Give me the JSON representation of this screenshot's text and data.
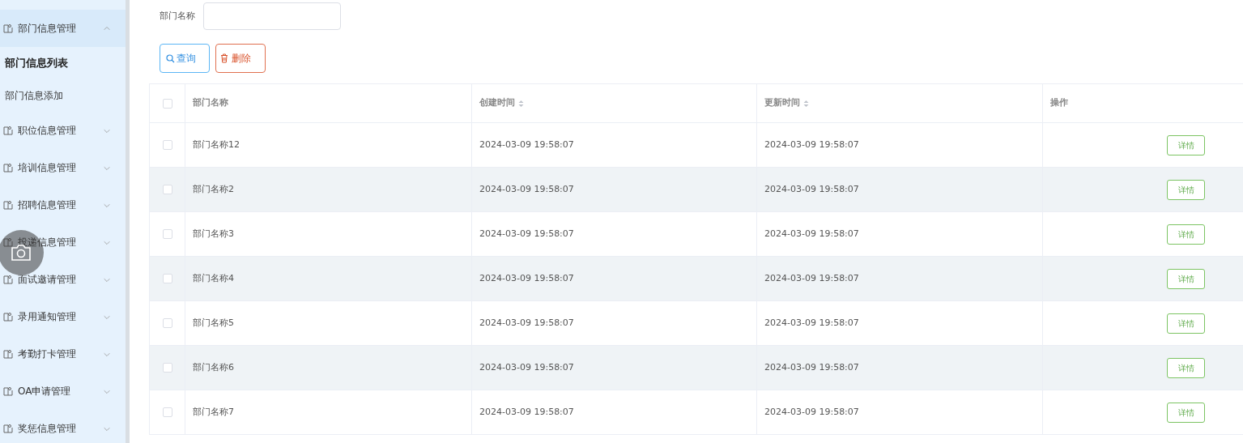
{
  "sidebar": {
    "items": [
      {
        "label": "部门信息管理",
        "expanded": true,
        "children": [
          {
            "label": "部门信息列表",
            "selected": true
          },
          {
            "label": "部门信息添加",
            "selected": false
          }
        ]
      },
      {
        "label": "职位信息管理",
        "expanded": false
      },
      {
        "label": "培训信息管理",
        "expanded": false
      },
      {
        "label": "招聘信息管理",
        "expanded": false
      },
      {
        "label": "投递信息管理",
        "expanded": false
      },
      {
        "label": "面试邀请管理",
        "expanded": false
      },
      {
        "label": "录用通知管理",
        "expanded": false
      },
      {
        "label": "考勤打卡管理",
        "expanded": false
      },
      {
        "label": "OA申请管理",
        "expanded": false
      },
      {
        "label": "奖惩信息管理",
        "expanded": false
      }
    ]
  },
  "search": {
    "label": "部门名称"
  },
  "buttons": [
    {
      "label": "查询",
      "kind": "query"
    },
    {
      "label": "删除",
      "kind": "delete"
    }
  ],
  "table": {
    "all_checked": false,
    "columns": [
      {
        "label": "部门名称",
        "sortable": false
      },
      {
        "label": "创建时间",
        "sortable": true
      },
      {
        "label": "更新时间",
        "sortable": true
      },
      {
        "label": "操作",
        "sortable": false
      }
    ],
    "rows": [
      {
        "checked": false,
        "name": "部门名称12",
        "created": "2024-03-09 19:58:07",
        "updated": "2024-03-09 19:58:07",
        "action": "详情"
      },
      {
        "checked": false,
        "name": "部门名称2",
        "created": "2024-03-09 19:58:07",
        "updated": "2024-03-09 19:58:07",
        "action": "详情"
      },
      {
        "checked": false,
        "name": "部门名称3",
        "created": "2024-03-09 19:58:07",
        "updated": "2024-03-09 19:58:07",
        "action": "详情"
      },
      {
        "checked": false,
        "name": "部门名称4",
        "created": "2024-03-09 19:58:07",
        "updated": "2024-03-09 19:58:07",
        "action": "详情"
      },
      {
        "checked": false,
        "name": "部门名称5",
        "created": "2024-03-09 19:58:07",
        "updated": "2024-03-09 19:58:07",
        "action": "详情"
      },
      {
        "checked": false,
        "name": "部门名称6",
        "created": "2024-03-09 19:58:07",
        "updated": "2024-03-09 19:58:07",
        "action": "详情"
      },
      {
        "checked": false,
        "name": "部门名称7",
        "created": "2024-03-09 19:58:07",
        "updated": "2024-03-09 19:58:07",
        "action": "详情"
      }
    ]
  }
}
